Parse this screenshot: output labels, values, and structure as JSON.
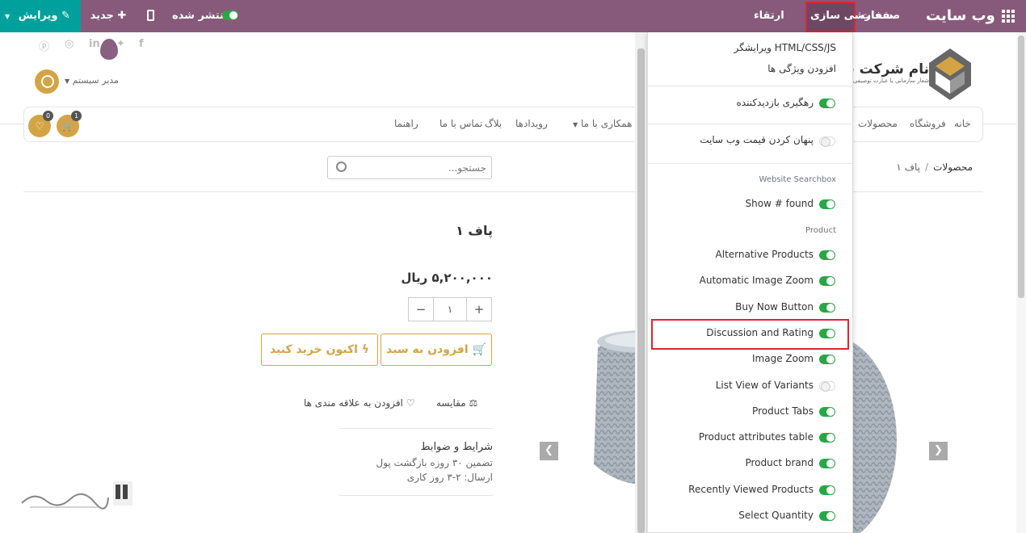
{
  "topbar": {
    "app_title": "وب سایت",
    "menu_pages": "صفحات",
    "menu_customize": "سفارشی سازی",
    "menu_upgrade": "ارتقاء",
    "published": "منتشر شده",
    "new_label": "جدید",
    "edit_label": "ویرایش",
    "colors": {
      "bar": "#875a7b",
      "edit": "#00a09d"
    }
  },
  "header": {
    "admin_name": "مدیر سیستم",
    "company_name": "نام شرکت شما",
    "company_slogan": "شعار سازمانی یا عبارت توصیفی"
  },
  "nav": {
    "items": [
      "خانه",
      "فروشگاه",
      "محصولات"
    ],
    "items_left": [
      "همکاری با ما",
      "رویدادها",
      "بلاگ",
      "تماس با ما",
      "راهنما"
    ],
    "wishlist_count": "0",
    "cart_count": "1"
  },
  "search": {
    "placeholder": "جستجو..."
  },
  "breadcrumb": {
    "parent": "محصولات",
    "sep": "/",
    "current": "پاف ۱"
  },
  "product": {
    "title": "پاف ۱",
    "price": "۵,۲۰۰,۰۰۰ ریال",
    "qty": "۱",
    "qty_minus": "−",
    "qty_plus": "+",
    "add_to_cart": "افزودن به سبد",
    "buy_now": "اکنون خرید کنید",
    "compare": "مقایسه",
    "wishlist": "افزودن به علاقه مندی ها",
    "terms_title": "شرایط و ضوابط",
    "terms_1": "تضمین ۳۰ روزه بازگشت پول",
    "terms_2": "ارسال: ۲-۳ روز کاری",
    "accent": "#d4a444"
  },
  "dropdown": {
    "html_editor": "ویرایشگر HTML/CSS/JS",
    "add_features": "افزودن ویژگی ها",
    "visitor_tracking": "رهگیری بازدیدکننده",
    "hide_price": "پنهان کردن قیمت وب سایت",
    "header_searchbox": "Website Searchbox",
    "show_found": "Show # found",
    "header_product": "Product",
    "options": [
      {
        "label": "Alternative Products",
        "on": true
      },
      {
        "label": "Automatic Image Zoom",
        "on": true
      },
      {
        "label": "Buy Now Button",
        "on": true
      },
      {
        "label": "Discussion and Rating",
        "on": true
      },
      {
        "label": "Image Zoom",
        "on": true
      },
      {
        "label": "List View of Variants",
        "on": false
      },
      {
        "label": "Product Tabs",
        "on": true
      },
      {
        "label": "Product attributes table",
        "on": true
      },
      {
        "label": "Product brand",
        "on": true
      },
      {
        "label": "Recently Viewed Products",
        "on": true
      },
      {
        "label": "Select Quantity",
        "on": true
      }
    ]
  }
}
